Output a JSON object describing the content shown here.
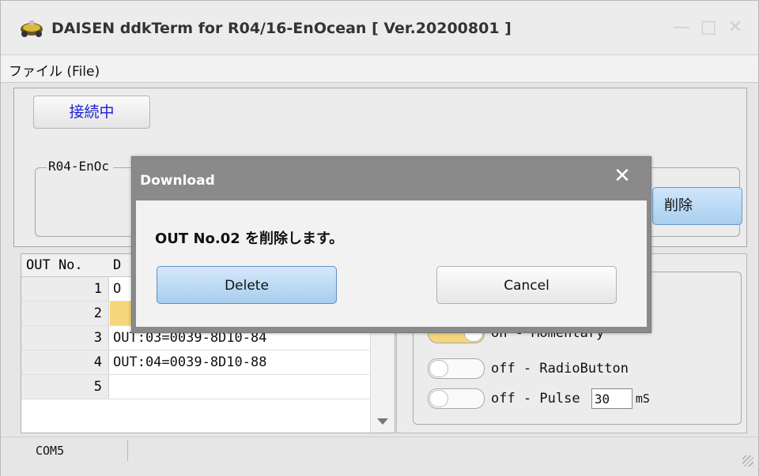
{
  "window": {
    "title": "DAISEN ddkTerm for R04/16-EnOcean [ Ver.20200801 ]",
    "icon": "rover-icon",
    "controls": [
      "minimize-icon",
      "maximize-icon",
      "close-icon"
    ]
  },
  "menu": {
    "file_label": "ファイル (File)"
  },
  "top": {
    "connect_label": "接続中",
    "group_label": "R04-EnOc",
    "delete_partial_label": "削除"
  },
  "list": {
    "headers": [
      "OUT No.",
      "D"
    ],
    "rows": [
      {
        "num": "1",
        "value": "O"
      },
      {
        "num": "2",
        "value": "",
        "selected": true
      },
      {
        "num": "3",
        "value": "OUT:03=0039-8D10-84"
      },
      {
        "num": "4",
        "value": "OUT:04=0039-8D10-88"
      },
      {
        "num": "5",
        "value": ""
      }
    ]
  },
  "options": {
    "momentary_label": "on  - Momentary",
    "momentary_state": "on",
    "radio_label": "off - RadioButton",
    "radio_state": "off",
    "pulse_label": "off - Pulse",
    "pulse_state": "off",
    "pulse_value": "30",
    "pulse_unit": "mS"
  },
  "status": {
    "port": "COM5"
  },
  "dialog": {
    "title": "Download",
    "message": "OUT No.02 を削除します。",
    "delete_label": "Delete",
    "cancel_label": "Cancel"
  },
  "colors": {
    "accent_blue": "#1a20d8",
    "selection": "#f5d67c",
    "dialog_frame": "#8a8a8a",
    "primary_button": "#a8cdee"
  }
}
